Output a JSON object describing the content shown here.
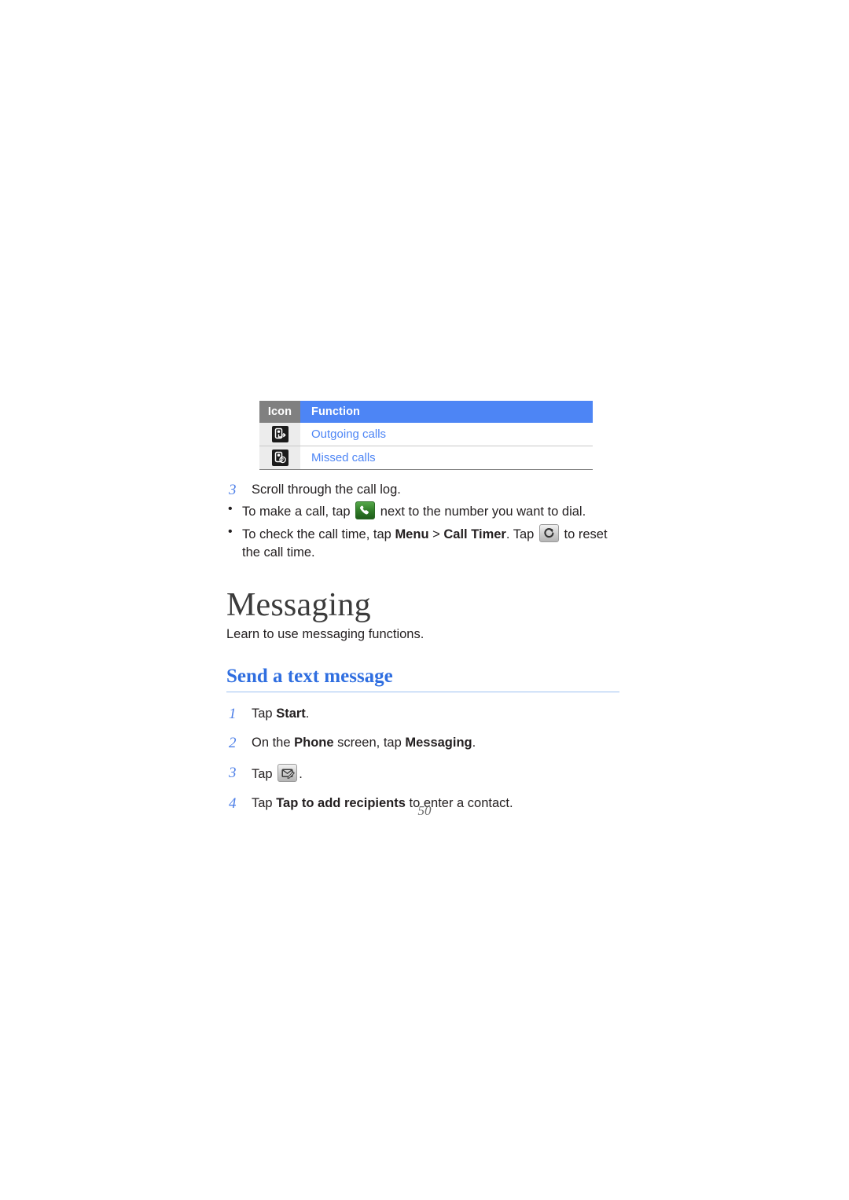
{
  "document": {
    "page_number": "50"
  },
  "icon_table": {
    "headers": {
      "icon": "Icon",
      "function": "Function"
    },
    "rows": [
      {
        "icon_name": "outgoing-call-icon",
        "function": "Outgoing calls"
      },
      {
        "icon_name": "missed-call-icon",
        "function": "Missed calls"
      }
    ]
  },
  "call_log_step": {
    "number": "3",
    "text": "Scroll through the call log.",
    "bullets": [
      {
        "part1": "To make a call, tap",
        "icon_name": "green-call-button-icon",
        "part2": "next to the number you want to dial."
      },
      {
        "part1": "To check the call time, tap",
        "bold1": "Menu",
        "separator": ">",
        "bold2": "Call Timer",
        "part2": ". Tap",
        "icon_name": "reset-button-icon",
        "part3": "to reset the call time."
      }
    ]
  },
  "messaging_section": {
    "title": "Messaging",
    "lede": "Learn to use messaging functions.",
    "subsection_title": "Send a text message",
    "steps": [
      {
        "number": "1",
        "pre": "Tap ",
        "bold": "Start",
        "post": "."
      },
      {
        "number": "2",
        "pre": "On the ",
        "bold": "Phone",
        "mid": " screen, tap ",
        "bold2": "Messaging",
        "post": "."
      },
      {
        "number": "3",
        "pre": "Tap ",
        "icon_name": "new-message-button-icon",
        "post": "."
      },
      {
        "number": "4",
        "pre": "Tap ",
        "bold": "Tap to add recipients",
        "post": " to enter a contact."
      }
    ]
  },
  "colors": {
    "accent_blue": "#4d85f5",
    "heading_blue": "#2f6ee0",
    "header_gray": "#808080",
    "icon_cell_gray": "#ececec",
    "body_text": "#231f20"
  }
}
